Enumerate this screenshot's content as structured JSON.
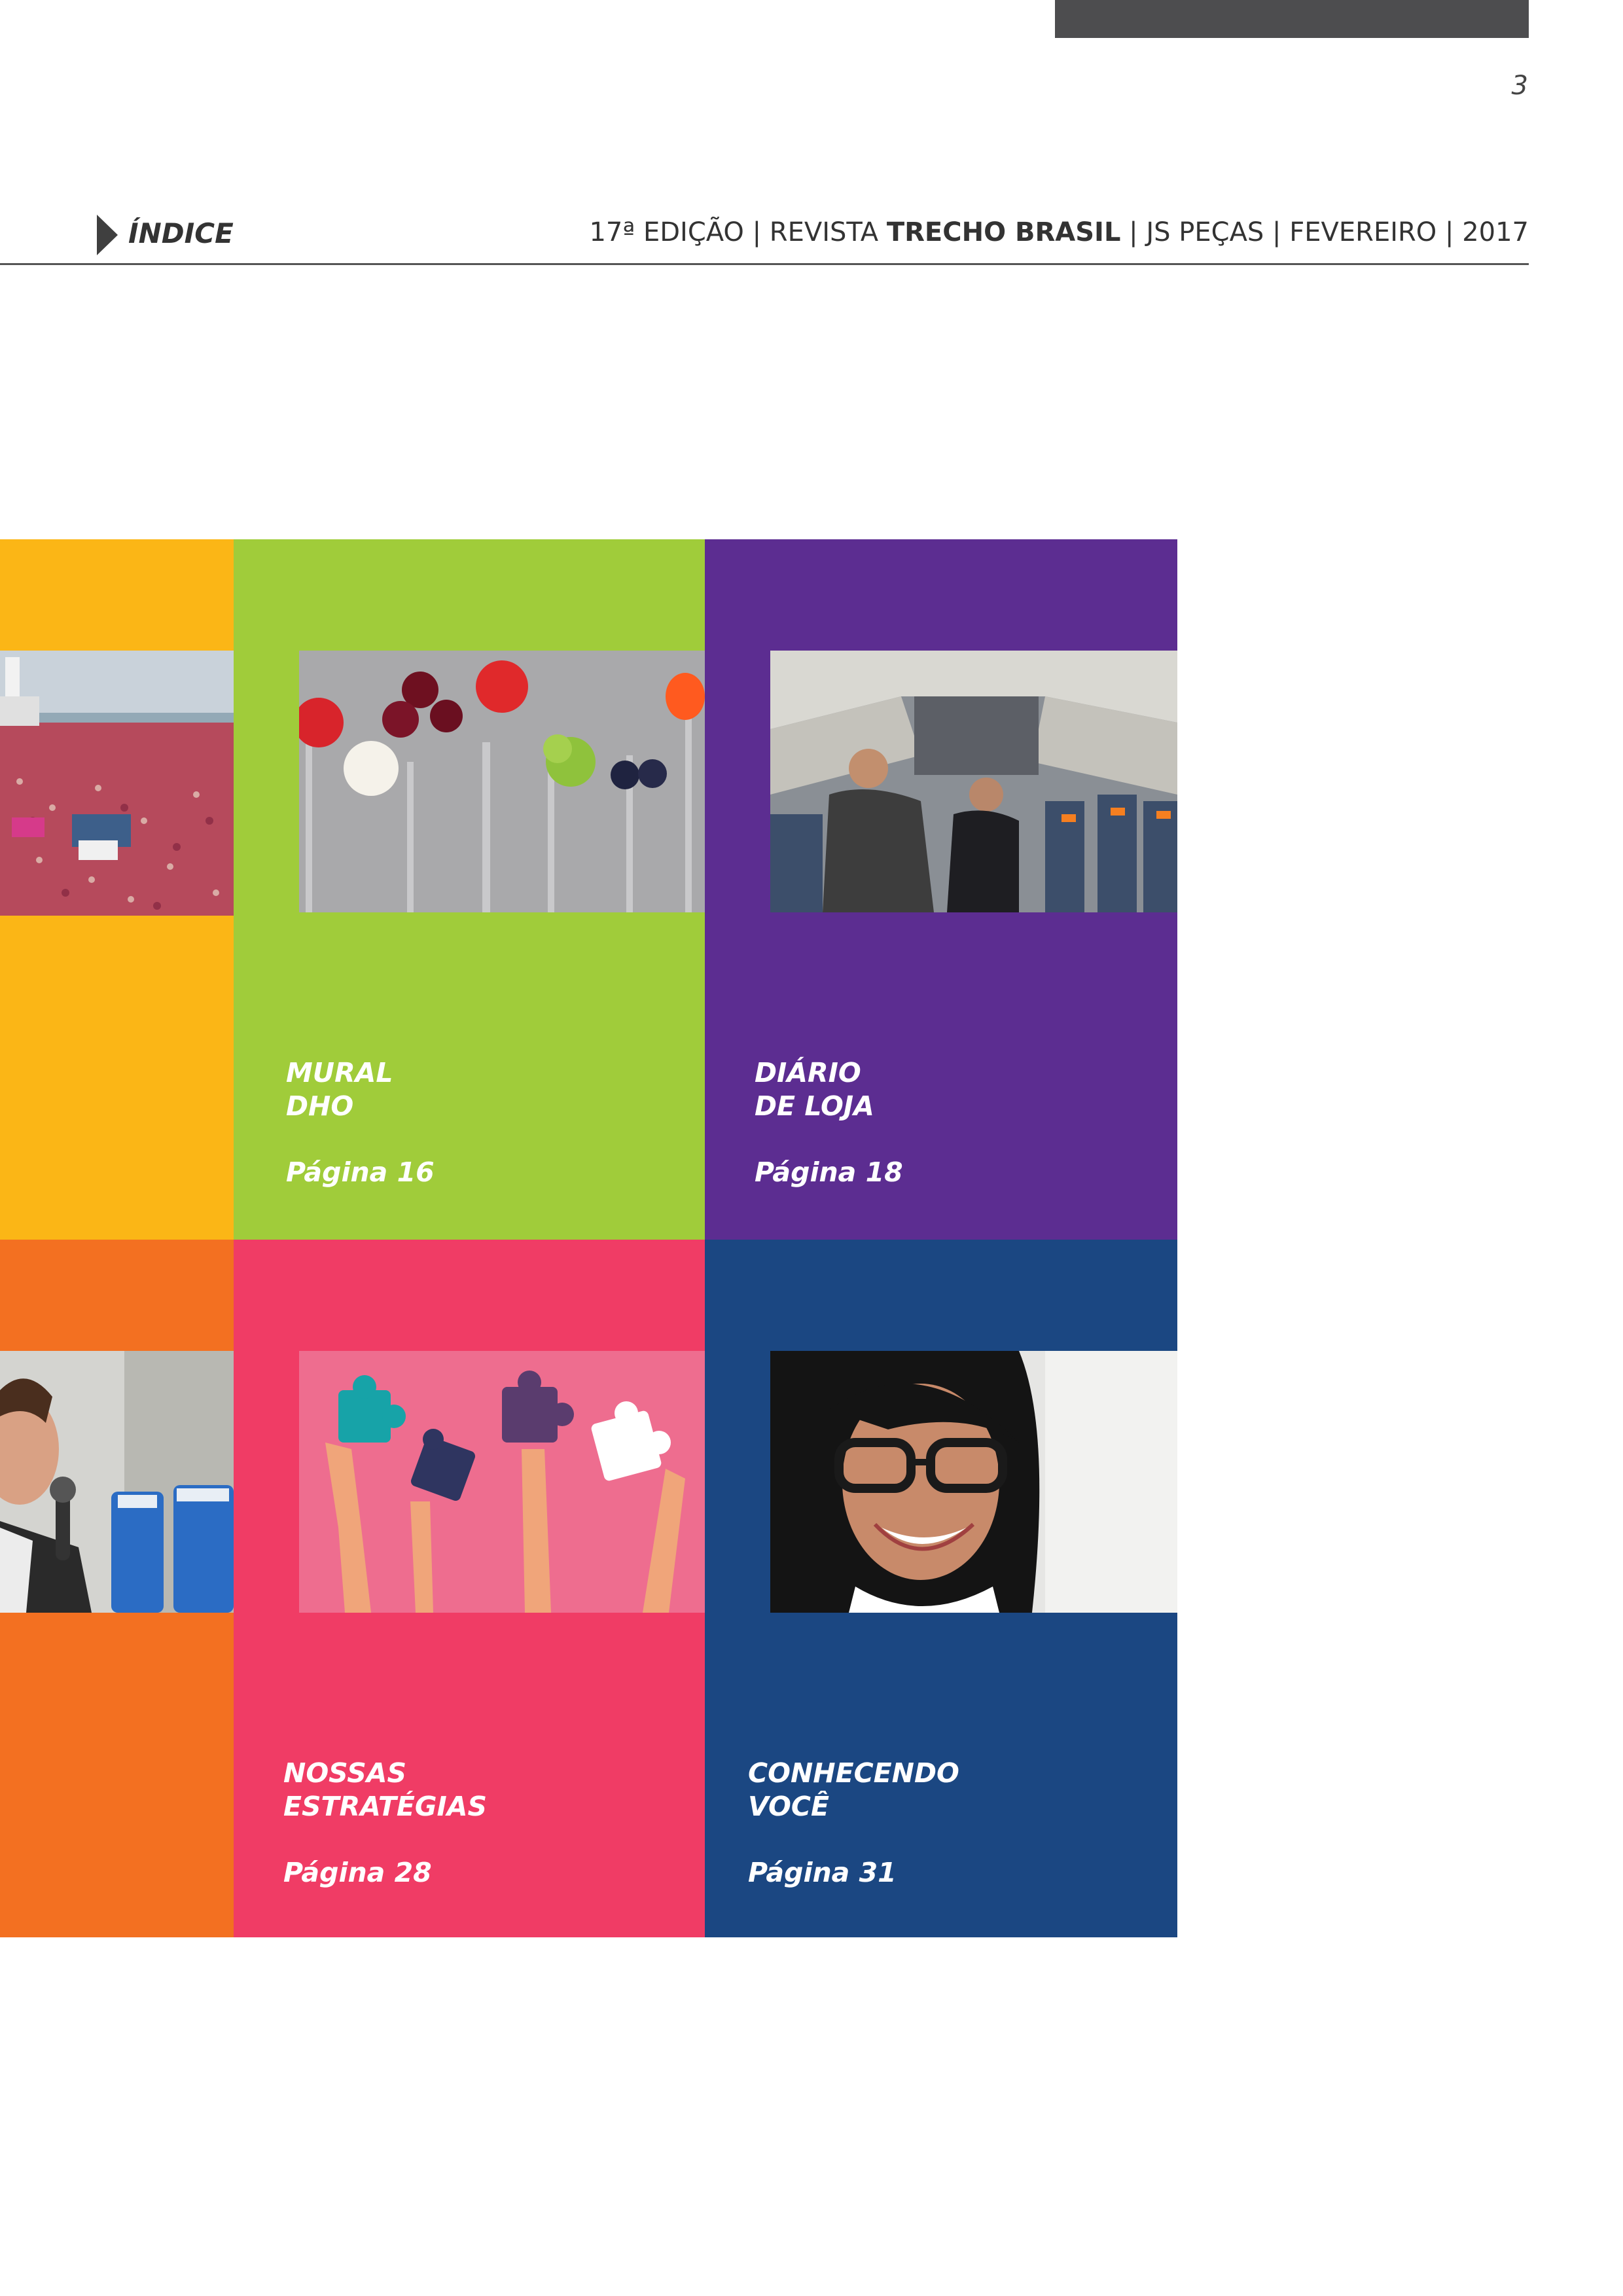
{
  "page_number": "3",
  "header": {
    "section": "ÍNDICE",
    "edition_pre": "17ª EDIÇÃO | REVISTA ",
    "edition_bold": "TRECHO BRASIL",
    "edition_post": " | JS PEÇAS | FEVEREIRO | 2017"
  },
  "tiles": [
    {
      "title": "MURAL\nDHO",
      "page": "Página 16",
      "color": "#a0cc3a"
    },
    {
      "title": "DIÁRIO\nDE LOJA",
      "page": "Página 18",
      "color": "#5c2d91"
    },
    {
      "title": "NOSSAS\nESTRATÉGIAS",
      "page": "Página 28",
      "color": "#f03c65"
    },
    {
      "title": "CONHECENDO\nVOCÊ",
      "page": "Página 31",
      "color": "#1b4782"
    }
  ],
  "side_tiles": {
    "top_color": "#fbb616",
    "bottom_color": "#f37021"
  }
}
